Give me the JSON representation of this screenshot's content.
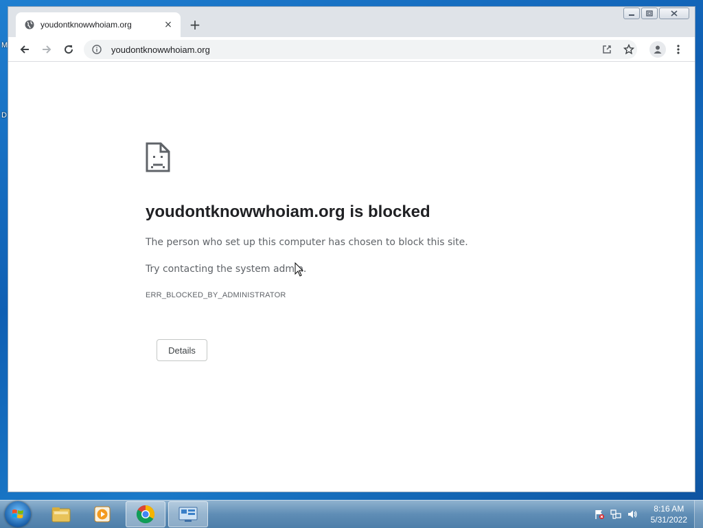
{
  "desktop": {
    "label_top": "M",
    "label_mid": "D"
  },
  "window": {
    "tab_title": "youdontknowwhoiam.org",
    "tab_close": "×",
    "new_tab": "+",
    "controls": {
      "minimize": "▭",
      "maximize": "◰",
      "close": "✕"
    }
  },
  "toolbar": {
    "url": "youdontknowwhoiam.org"
  },
  "error_page": {
    "heading": "youdontknowwhoiam.org is blocked",
    "message": "The person who set up this computer has chosen to block this site.",
    "suggestion": "Try contacting the system admin.",
    "error_code": "ERR_BLOCKED_BY_ADMINISTRATOR",
    "details_button": "Details"
  },
  "taskbar": {
    "time": "8:16 AM",
    "date": "5/31/2022",
    "pinned": [
      "file-explorer-icon",
      "media-player-icon",
      "chrome-icon",
      "control-panel-icon"
    ]
  },
  "colors": {
    "accent": "#1a73e8",
    "text": "#202124",
    "muted": "#5f6368"
  }
}
